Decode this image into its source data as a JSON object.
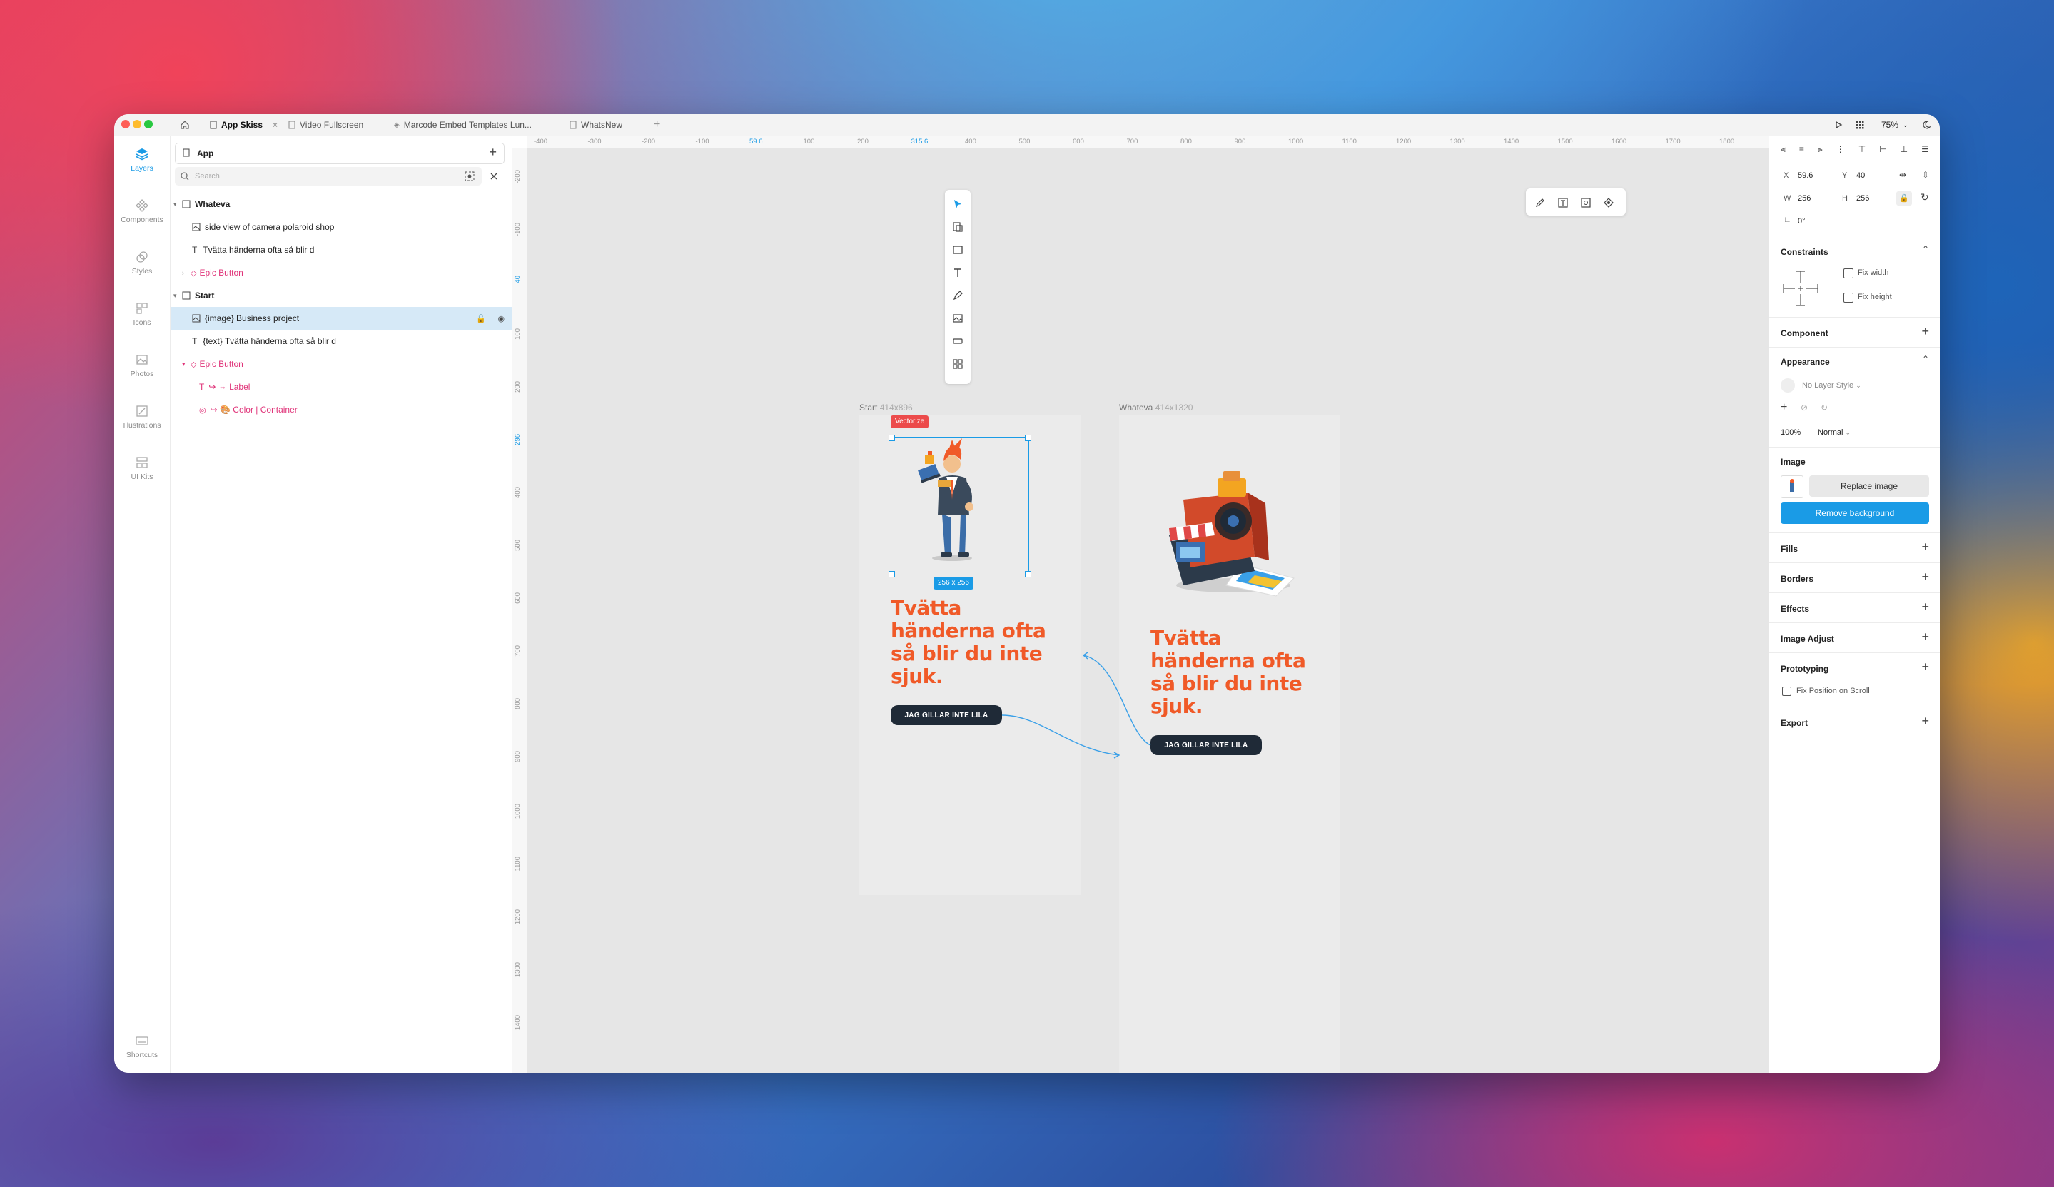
{
  "tabs": [
    {
      "label": "App Skiss",
      "active": true
    },
    {
      "label": "Video Fullscreen"
    },
    {
      "label": "Marcode Embed Templates Lun..."
    },
    {
      "label": "WhatsNew"
    }
  ],
  "topright": {
    "zoom": "75%"
  },
  "leftnav": [
    {
      "label": "Layers",
      "active": true
    },
    {
      "label": "Components"
    },
    {
      "label": "Styles"
    },
    {
      "label": "Icons"
    },
    {
      "label": "Photos"
    },
    {
      "label": "Illustrations"
    },
    {
      "label": "UI Kits"
    },
    {
      "label": "Shortcuts"
    }
  ],
  "layers": {
    "page": "App",
    "search_placeholder": "Search",
    "rows": [
      {
        "label": "Whateva",
        "indent": 0,
        "type": "artboard"
      },
      {
        "label": "side view of camera polaroid shop",
        "indent": 1,
        "type": "image"
      },
      {
        "label": "Tvätta händerna ofta så blir d",
        "indent": 1,
        "type": "text"
      },
      {
        "label": "Epic Button",
        "indent": 1,
        "type": "component"
      },
      {
        "label": "Start",
        "indent": 0,
        "type": "artboard"
      },
      {
        "label": "{image} Business project",
        "indent": 1,
        "type": "image",
        "selected": true
      },
      {
        "label": "{text} Tvätta händerna ofta så blir d",
        "indent": 1,
        "type": "text"
      },
      {
        "label": "Epic Button",
        "indent": 1,
        "type": "component"
      },
      {
        "label": "↪ ⇔ Label",
        "indent": 2,
        "type": "text-pink"
      },
      {
        "label": "↪ 🎨  Color | Container",
        "indent": 2,
        "type": "style"
      }
    ]
  },
  "hruler": [
    "-400",
    "-300",
    "-200",
    "-100",
    "59.6",
    "100",
    "200",
    "315.6",
    "400",
    "500",
    "600",
    "700",
    "800",
    "900",
    "1000",
    "1100",
    "1200",
    "1300",
    "1400",
    "1500",
    "1600",
    "1700",
    "1800"
  ],
  "vruler": [
    "-200",
    "-100",
    "40",
    "100",
    "200",
    "296",
    "400",
    "500",
    "600",
    "700",
    "800",
    "900",
    "1000",
    "1100",
    "1200",
    "1300",
    "1400"
  ],
  "canvas": {
    "start": {
      "name": "Start",
      "size": "414x896",
      "headline": "Tvätta händerna ofta så blir du inte sjuk.",
      "cta": "JAG GILLAR INTE LILA"
    },
    "whateva": {
      "name": "Whateva",
      "size": "414x1320",
      "headline": "Tvätta händerna ofta så blir du inte sjuk.",
      "cta": "JAG GILLAR INTE LILA"
    },
    "vectorize": "Vectorize",
    "selection_size": "256 x 256"
  },
  "inspector": {
    "x_label": "X",
    "x": "59.6",
    "y_label": "Y",
    "y": "40",
    "w_label": "W",
    "w": "256",
    "h_label": "H",
    "h": "256",
    "rotation": "0°",
    "constraints": "Constraints",
    "fix_width": "Fix width",
    "fix_height": "Fix height",
    "component": "Component",
    "appearance": "Appearance",
    "layer_style": "No Layer Style",
    "opacity": "100%",
    "blend": "Normal",
    "image": "Image",
    "replace": "Replace image",
    "remove_bg": "Remove background",
    "fills": "Fills",
    "borders": "Borders",
    "effects": "Effects",
    "image_adjust": "Image Adjust",
    "prototyping": "Prototyping",
    "fix_scroll": "Fix Position on Scroll",
    "export": "Export"
  },
  "colors": {
    "accent": "#1a9be6",
    "headline": "#f05a28",
    "cta": "#1f2a37",
    "selection": "#d6e9f7",
    "pink": "#e0357a"
  }
}
